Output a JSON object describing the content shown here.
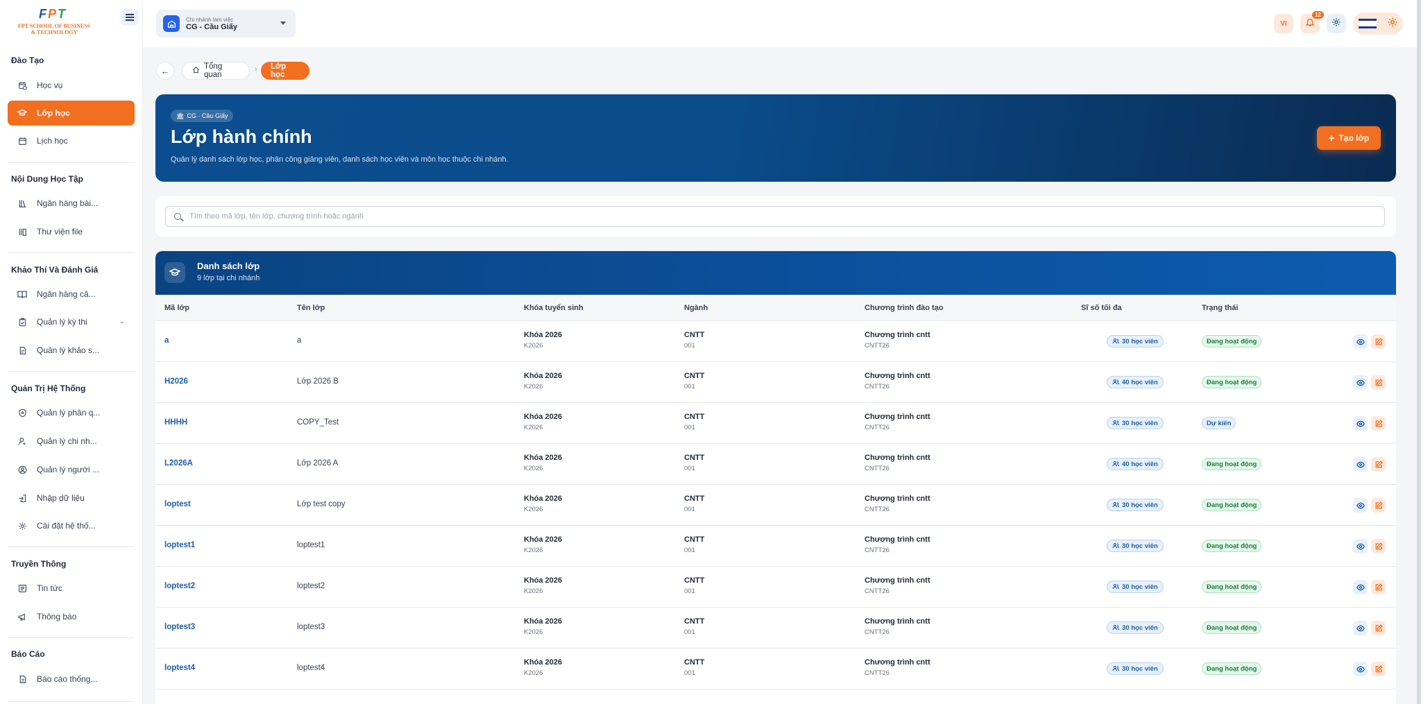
{
  "logo": {
    "brand_letters": [
      "F",
      "P",
      "T"
    ],
    "brand_colors": [
      "#1e56a0",
      "#f26f21",
      "#2a9d4a"
    ],
    "school_line1": "FPT SCHOOL OF BUSINESS",
    "school_line2": "& TECHNOLOGY"
  },
  "sidebar": {
    "sections": [
      {
        "title": "Đào Tạo"
      },
      {
        "title": "Nội Dung Học Tập"
      },
      {
        "title": "Khảo Thí Và Đánh Giá"
      },
      {
        "title": "Quản Trị Hệ Thống"
      },
      {
        "title": "Truyền Thông"
      },
      {
        "title": "Báo Cáo"
      }
    ],
    "items": [
      {
        "label": "Học vụ",
        "icon": "calendar-clock-icon"
      },
      {
        "label": "Lớp học",
        "icon": "graduation-cap-icon",
        "active": true
      },
      {
        "label": "Lịch học",
        "icon": "calendar-icon"
      },
      {
        "label": "Ngân hàng bài...",
        "icon": "library-icon"
      },
      {
        "label": "Thư viện file",
        "icon": "file-library-icon"
      },
      {
        "label": "Ngân hàng câ...",
        "icon": "book-open-icon"
      },
      {
        "label": "Quản lý kỳ thi",
        "icon": "clipboard-check-icon"
      },
      {
        "label": "Quản lý khảo s...",
        "icon": "survey-icon"
      },
      {
        "label": "Quản lý phân q...",
        "icon": "shield-icon"
      },
      {
        "label": "Quản lý chi nh...",
        "icon": "user-branch-icon"
      },
      {
        "label": "Quản lý người ...",
        "icon": "user-circle-icon"
      },
      {
        "label": "Nhập dữ liệu",
        "icon": "import-icon"
      },
      {
        "label": "Cài đặt hệ thố...",
        "icon": "gear-icon"
      },
      {
        "label": "Tin tức",
        "icon": "newspaper-icon"
      },
      {
        "label": "Thông báo",
        "icon": "megaphone-icon"
      },
      {
        "label": "Báo cáo thống...",
        "icon": "report-icon"
      }
    ]
  },
  "topbar": {
    "branch_caption": "Chi nhánh làm việc",
    "branch_name": "CG - Cầu Giấy",
    "lang": "VI",
    "notification_count": "12"
  },
  "breadcrumb": {
    "home": "Tổng quan",
    "current": "Lớp học"
  },
  "hero": {
    "chip": "CG · Cầu Giấy",
    "title": "Lớp hành chính",
    "description": "Quản lý danh sách lớp học, phân công giảng viên, danh sách học viên và môn học thuộc chi nhánh.",
    "create_label": "Tạo lớp"
  },
  "search": {
    "placeholder": "Tìm theo mã lớp, tên lớp, chương trình hoặc ngành",
    "value": ""
  },
  "table": {
    "title": "Danh sách lớp",
    "subtitle": "9 lớp tại chi nhánh",
    "columns": [
      "Mã lớp",
      "Tên lớp",
      "Khóa tuyển sinh",
      "Ngành",
      "Chương trình đào tạo",
      "Sĩ số tối đa",
      "Trạng thái"
    ],
    "rows": [
      {
        "code": "a",
        "name": "a",
        "intake": "Khóa 2026",
        "intake_code": "K2026",
        "major": "CNTT",
        "major_code": "001",
        "program": "Chương trình cntt",
        "program_code": "CNTT26",
        "capacity": "30 học viên",
        "status": "Đang hoạt động",
        "status_type": "active"
      },
      {
        "code": "H2026",
        "name": "Lớp 2026 B",
        "intake": "Khóa 2026",
        "intake_code": "K2026",
        "major": "CNTT",
        "major_code": "001",
        "program": "Chương trình cntt",
        "program_code": "CNTT26",
        "capacity": "40 học viên",
        "status": "Đang hoạt động",
        "status_type": "active"
      },
      {
        "code": "HHHH",
        "name": "COPY_Test",
        "intake": "Khóa 2026",
        "intake_code": "K2026",
        "major": "CNTT",
        "major_code": "001",
        "program": "Chương trình cntt",
        "program_code": "CNTT26",
        "capacity": "30 học viên",
        "status": "Dự kiến",
        "status_type": "planned"
      },
      {
        "code": "L2026A",
        "name": "Lớp 2026 A",
        "intake": "Khóa 2026",
        "intake_code": "K2026",
        "major": "CNTT",
        "major_code": "001",
        "program": "Chương trình cntt",
        "program_code": "CNTT26",
        "capacity": "40 học viên",
        "status": "Đang hoạt động",
        "status_type": "active"
      },
      {
        "code": "loptest",
        "name": "Lớp test copy",
        "intake": "Khóa 2026",
        "intake_code": "K2026",
        "major": "CNTT",
        "major_code": "001",
        "program": "Chương trình cntt",
        "program_code": "CNTT26",
        "capacity": "30 học viên",
        "status": "Đang hoạt động",
        "status_type": "active"
      },
      {
        "code": "loptest1",
        "name": "loptest1",
        "intake": "Khóa 2026",
        "intake_code": "K2026",
        "major": "CNTT",
        "major_code": "001",
        "program": "Chương trình cntt",
        "program_code": "CNTT26",
        "capacity": "30 học viên",
        "status": "Đang hoạt động",
        "status_type": "active"
      },
      {
        "code": "loptest2",
        "name": "loptest2",
        "intake": "Khóa 2026",
        "intake_code": "K2026",
        "major": "CNTT",
        "major_code": "001",
        "program": "Chương trình cntt",
        "program_code": "CNTT26",
        "capacity": "30 học viên",
        "status": "Đang hoạt động",
        "status_type": "active"
      },
      {
        "code": "loptest3",
        "name": "loptest3",
        "intake": "Khóa 2026",
        "intake_code": "K2026",
        "major": "CNTT",
        "major_code": "001",
        "program": "Chương trình cntt",
        "program_code": "CNTT26",
        "capacity": "30 học viên",
        "status": "Đang hoạt động",
        "status_type": "active"
      },
      {
        "code": "loptest4",
        "name": "loptest4",
        "intake": "Khóa 2026",
        "intake_code": "K2026",
        "major": "CNTT",
        "major_code": "001",
        "program": "Chương trình cntt",
        "program_code": "CNTT26",
        "capacity": "30 học viên",
        "status": "Đang hoạt động",
        "status_type": "active"
      }
    ]
  },
  "colors": {
    "accent": "#f26f21",
    "primary": "#0b4d8e",
    "link": "#1d5ea8",
    "success": "#15803d"
  }
}
